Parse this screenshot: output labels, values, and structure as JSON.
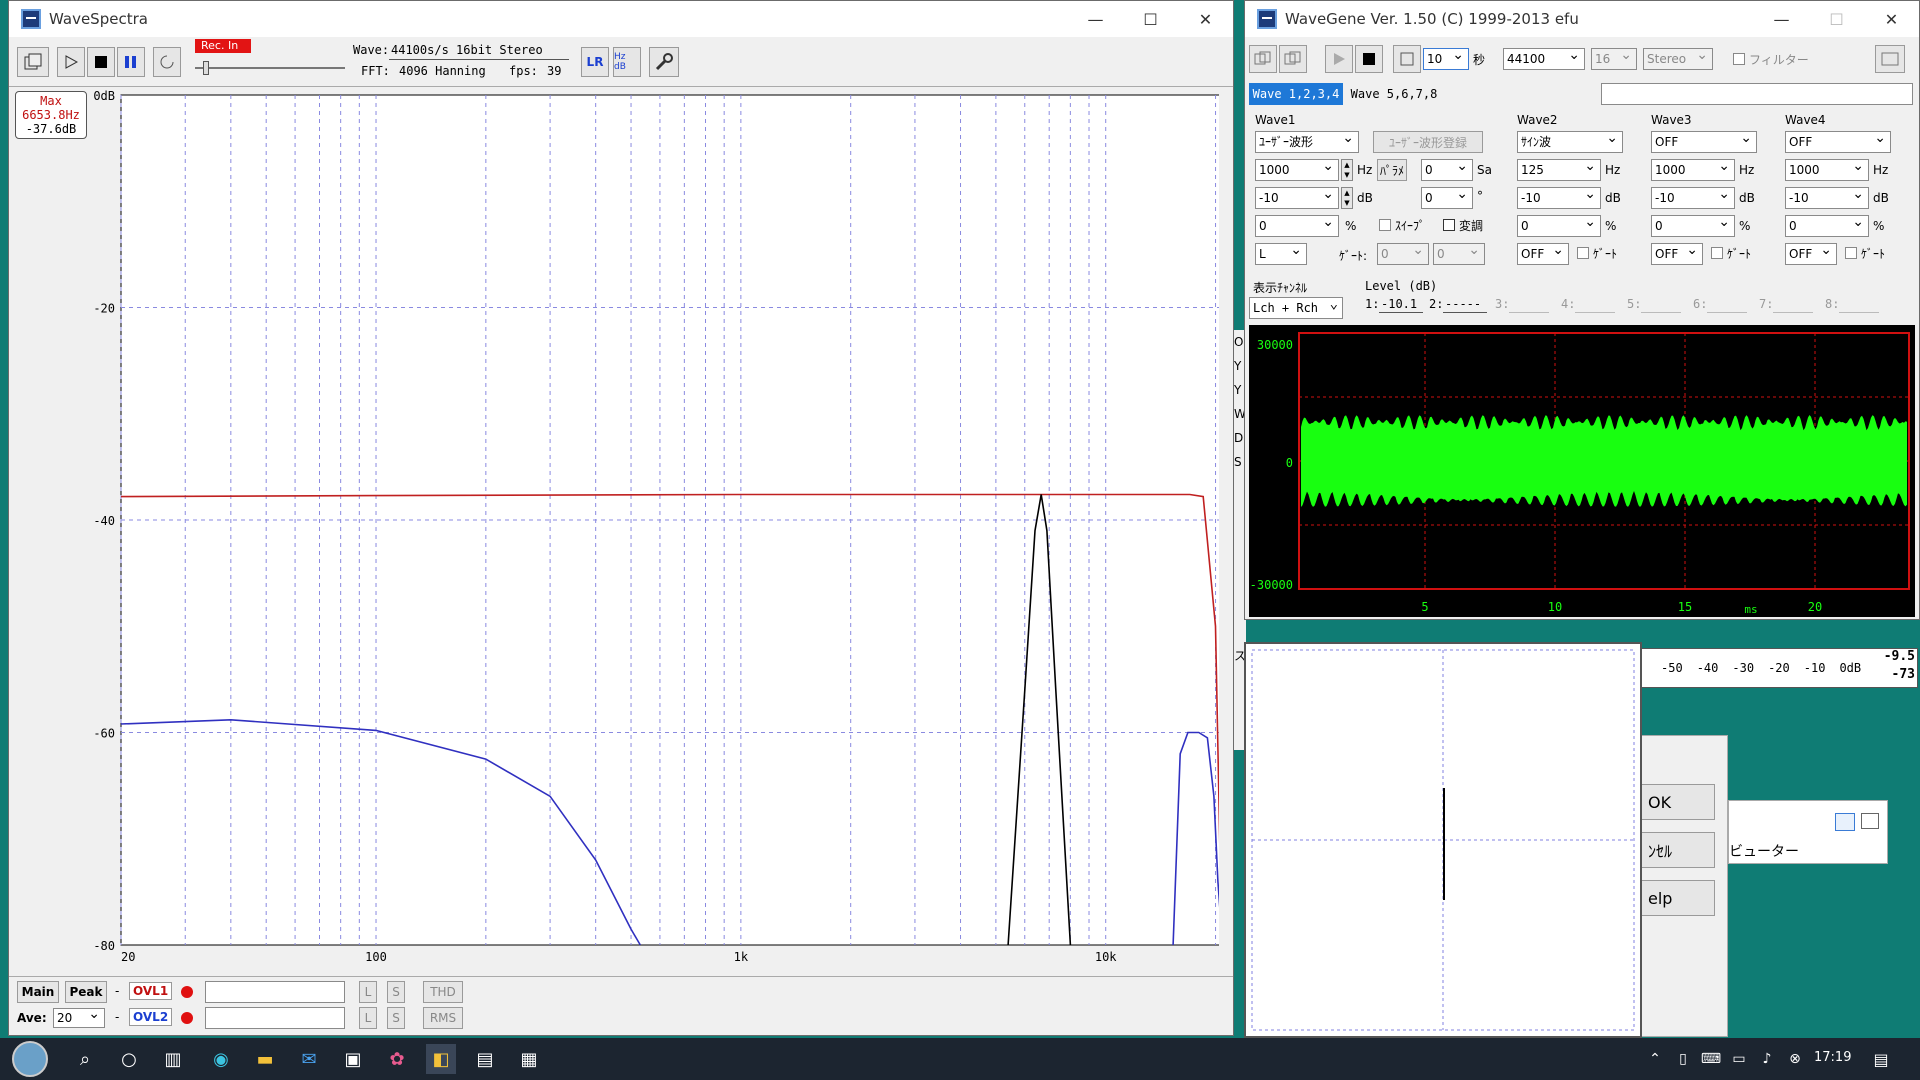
{
  "wavespectra": {
    "title": "WaveSpectra",
    "rec_badge": "Rec. In",
    "wave_label": "Wave:",
    "wave_value": "44100s/s 16bit Stereo",
    "fft_label": "FFT:",
    "fft_value": "4096 Hanning",
    "fps_label": "fps:",
    "fps_value": "39",
    "lr_button": "LR",
    "hzdb_button": "Hz dB",
    "max_label": "Max",
    "max_freq": "6653.8Hz",
    "max_db": "-37.6dB",
    "y_ticks": [
      "0dB",
      "-20",
      "-40",
      "-60",
      "-80"
    ],
    "x_ticks": [
      "20",
      "100",
      "1k",
      "10k"
    ],
    "main_tab": "Main",
    "peak_tab": "Peak",
    "ovl1": "OVL1",
    "ovl2": "OVL2",
    "ave_label": "Ave:",
    "ave_value": "20",
    "l_btn": "L",
    "s_btn": "S",
    "thd_btn": "THD",
    "rms_btn": "RMS",
    "dash": "-"
  },
  "chart_data": {
    "type": "line",
    "title": "",
    "xlabel": "",
    "ylabel": "",
    "x_scale": "log",
    "xlim": [
      20,
      22050
    ],
    "ylim": [
      -80,
      0
    ],
    "grid": true,
    "series": [
      {
        "color": "#c02020",
        "x": [
          20,
          100,
          1000,
          5000,
          10000,
          17000,
          18500,
          20000,
          20800
        ],
        "y": [
          -37.8,
          -37.7,
          -37.6,
          -37.6,
          -37.6,
          -37.6,
          -37.8,
          -50,
          -80
        ]
      },
      {
        "color": "#000000",
        "x": [
          5400,
          6000,
          6400,
          6653.8,
          6900,
          7300,
          8000
        ],
        "y": [
          -80,
          -56,
          -41,
          -37.6,
          -41,
          -56,
          -80
        ]
      },
      {
        "color": "#3030c0",
        "x": [
          20,
          40,
          100,
          200,
          300,
          400,
          500,
          530
        ],
        "y": [
          -59.2,
          -58.8,
          -59.8,
          -62.5,
          -66,
          -72,
          -78.5,
          -80
        ]
      },
      {
        "color": "#3030c0",
        "x": [
          15300,
          16000,
          16800,
          18000,
          19000,
          19800,
          20300,
          20900
        ],
        "y": [
          -80,
          -62,
          -60,
          -60,
          -60.5,
          -66,
          -74,
          -80
        ]
      }
    ]
  },
  "wavegene": {
    "title": "WaveGene Ver. 1.50 (C) 1999-2013 efu",
    "time_value": "10",
    "time_unit": "秒",
    "rate_value": "44100",
    "bits_value": "16",
    "stereo_value": "Stereo",
    "filter_label": "フィルター",
    "tab1": "Wave 1,2,3,4",
    "tab2": "Wave 5,6,7,8",
    "wave1": {
      "label": "Wave1",
      "type": "ﾕｰｻﾞｰ波形",
      "register": "ﾕｰｻﾞｰ波形登録",
      "freq": "1000",
      "hz": "Hz",
      "level": "-10",
      "db": "dB",
      "pct_value": "0",
      "pct": "%",
      "channel": "L",
      "param_label": "ﾊﾟﾗﾒ",
      "sa_value": "0",
      "sa_label": "Sa",
      "deg_value": "0",
      "deg_label": "°",
      "sweep_label": "ｽｲｰﾌﾟ",
      "mod_label": "変調",
      "gate_label": "ｹﾞｰﾄ:",
      "gate1": "0",
      "gate2": "0"
    },
    "wave2": {
      "label": "Wave2",
      "type": "ｻｲﾝ波",
      "freq": "125",
      "level": "-10",
      "pct_value": "0",
      "gate": "OFF",
      "gate_label": "ｹﾞｰﾄ"
    },
    "wave3": {
      "label": "Wave3",
      "type": "OFF",
      "freq": "1000",
      "level": "-10",
      "pct_value": "0",
      "gate": "OFF",
      "gate_label": "ｹﾞｰﾄ"
    },
    "wave4": {
      "label": "Wave4",
      "type": "OFF",
      "freq": "1000",
      "level": "-10",
      "pct_value": "0",
      "gate": "OFF",
      "gate_label": "ｹﾞｰﾄ"
    },
    "display_channel_label": "表示ﾁｬﾝﾈﾙ",
    "display_channel": "Lch + Rch",
    "level_label": "Level (dB)",
    "levels": [
      {
        "n": "1:",
        "v": "-10.1"
      },
      {
        "n": "2:",
        "v": "-----"
      },
      {
        "n": "3:",
        "v": ""
      },
      {
        "n": "4:",
        "v": ""
      },
      {
        "n": "5:",
        "v": ""
      },
      {
        "n": "6:",
        "v": ""
      },
      {
        "n": "7:",
        "v": ""
      },
      {
        "n": "8:",
        "v": ""
      }
    ],
    "scope": {
      "y_top": "30000",
      "y_mid": "0",
      "y_bot": "-30000",
      "x_ticks": [
        "5",
        "10",
        "15",
        "20"
      ],
      "x_unit": "ms"
    }
  },
  "level_meter": {
    "ticks": [
      "-50",
      "-40",
      "-30",
      "-20",
      "-10",
      "0dB"
    ],
    "reading1": "-9.5",
    "reading2": "-73"
  },
  "dialog": {
    "ok": "OK",
    "cancel": "ﾝｾﾙ",
    "help": "elp",
    "viewer_label": "ビューター"
  },
  "left_edge": [
    "O",
    "Y",
    "Y",
    "W",
    "DI",
    "S",
    "ス"
  ],
  "taskbar": {
    "time": "17:19"
  }
}
